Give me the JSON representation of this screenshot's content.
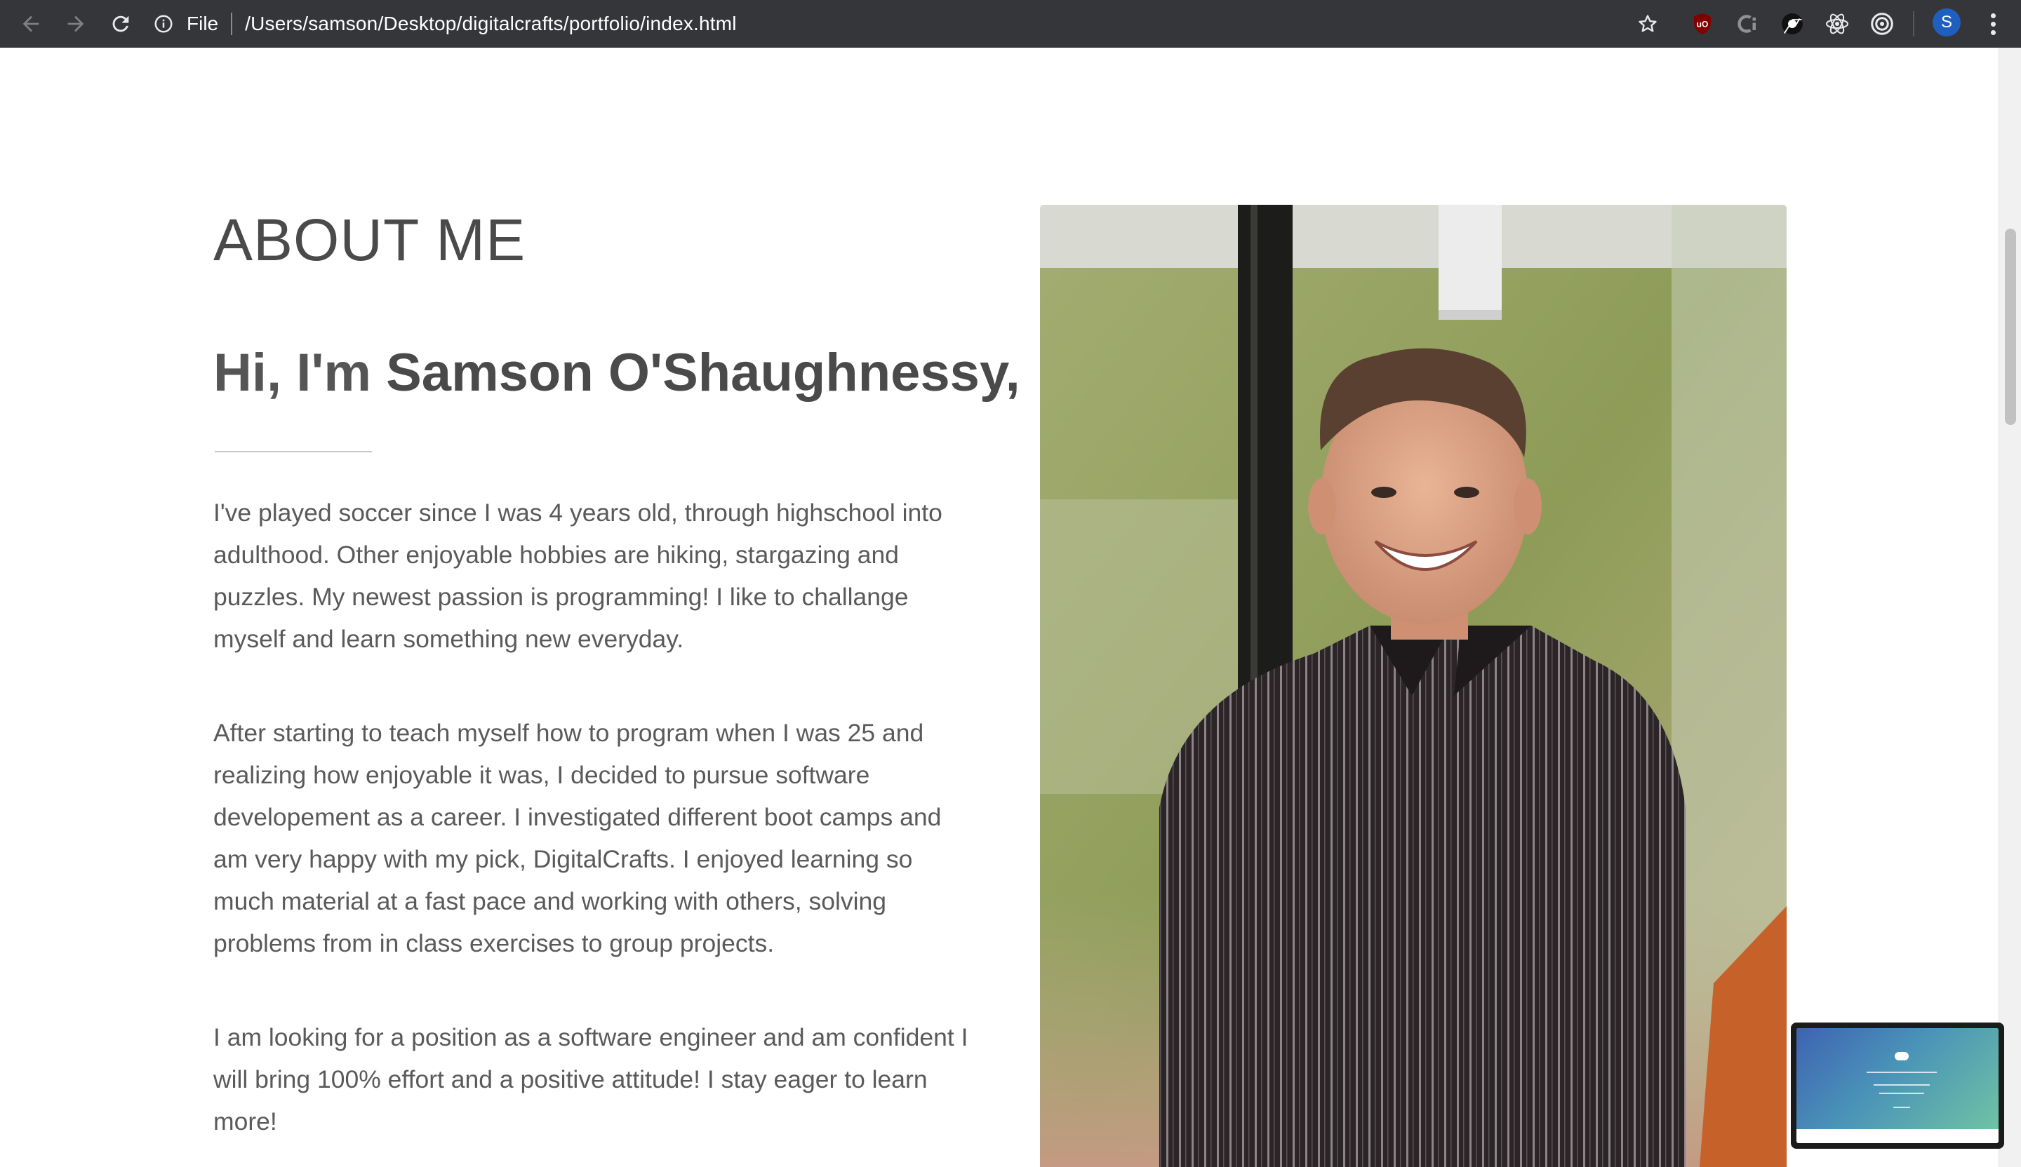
{
  "browser": {
    "omnibox": {
      "scheme_label": "File",
      "url": "/Users/samson/Desktop/digitalcrafts/portfolio/index.html"
    },
    "icons": [
      "back-arrow-icon",
      "forward-arrow-icon",
      "reload-icon",
      "info-icon",
      "bookmark-star-icon",
      "ublock-icon",
      "coda-icon",
      "chrome-extension-icon",
      "react-devtools-icon",
      "target-extension-icon",
      "menu-kebab-icon"
    ],
    "profile_initial": "S"
  },
  "about": {
    "heading": "ABOUT ME",
    "greeting_prefix": "Hi, I'm ",
    "name": "Samson O'Shaughnessy,",
    "paragraphs": [
      "I've played soccer since I was 4 years old, through highschool into adulthood. Other enjoyable hobbies are hiking, stargazing and puzzles. My newest passion is programming! I like to challange myself and learn something new everyday.",
      "After starting to teach myself how to program when I was 25 and realizing how enjoyable it was, I decided to pursue software developement as a career. I investigated different boot camps and am very happy with my pick, DigitalCrafts. I enjoyed learning so much material at a fast pace and working with others, solving problems from in class exercises to group projects.",
      "I am looking for a position as a software engineer and am confident I will bring 100% effort and a positive attitude! I stay eager to learn more!"
    ]
  },
  "colors": {
    "chrome_bar": "#35363a",
    "heading_text": "#4a4a4a",
    "body_text": "#5a5a5a",
    "photo_background": "#8f9a5a",
    "shirt": "#2c2628"
  }
}
